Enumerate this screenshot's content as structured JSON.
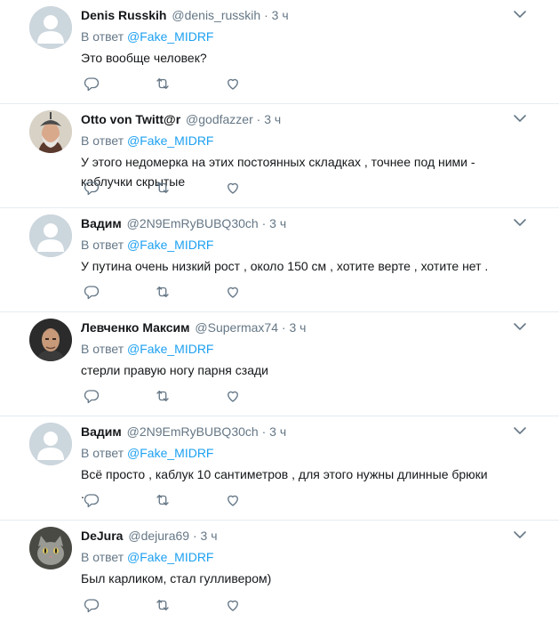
{
  "reply_prefix": "В ответ",
  "tweets": [
    {
      "name": "Denis Russkih",
      "handle": "@denis_russkih",
      "dot": "·",
      "time": "3 ч",
      "mention": "@Fake_MIDRF",
      "text": "Это вообще человек?",
      "avatar": "default-avatar"
    },
    {
      "name": "Otto von Twitt@r",
      "handle": "@godfazzer",
      "dot": "·",
      "time": "3 ч",
      "mention": "@Fake_MIDRF",
      "text": "У этого недомерка на этих постоянных складках , точнее под ними - каблучки скрытые",
      "avatar": "bearded-man-with-helmet-avatar"
    },
    {
      "name": "Вадим",
      "handle": "@2N9EmRyBUBQ30ch",
      "dot": "·",
      "time": "3 ч",
      "mention": "@Fake_MIDRF",
      "text": "У путина очень низкий рост , около 150 см , хотите верте , хотите нет .",
      "avatar": "default-avatar"
    },
    {
      "name": "Левченко Максим",
      "handle": "@Supermax74",
      "dot": "·",
      "time": "3 ч",
      "mention": "@Fake_MIDRF",
      "text": "стерли правую ногу парня сзади",
      "avatar": "man-portrait-avatar"
    },
    {
      "name": "Вадим",
      "handle": "@2N9EmRyBUBQ30ch",
      "dot": "·",
      "time": "3 ч",
      "mention": "@Fake_MIDRF",
      "text": "Всё просто , каблук 10 сантиметров , для этого нужны длинные брюки .",
      "avatar": "default-avatar"
    },
    {
      "name": "DeJura",
      "handle": "@dejura69",
      "dot": "·",
      "time": "3 ч",
      "mention": "@Fake_MIDRF",
      "text": "Был карликом, стал гулливером)",
      "avatar": "cat-avatar"
    }
  ],
  "colors": {
    "link": "#1da1f2",
    "secondary_text": "#657786",
    "primary_text": "#14171a",
    "divider": "#e6ecf0"
  }
}
